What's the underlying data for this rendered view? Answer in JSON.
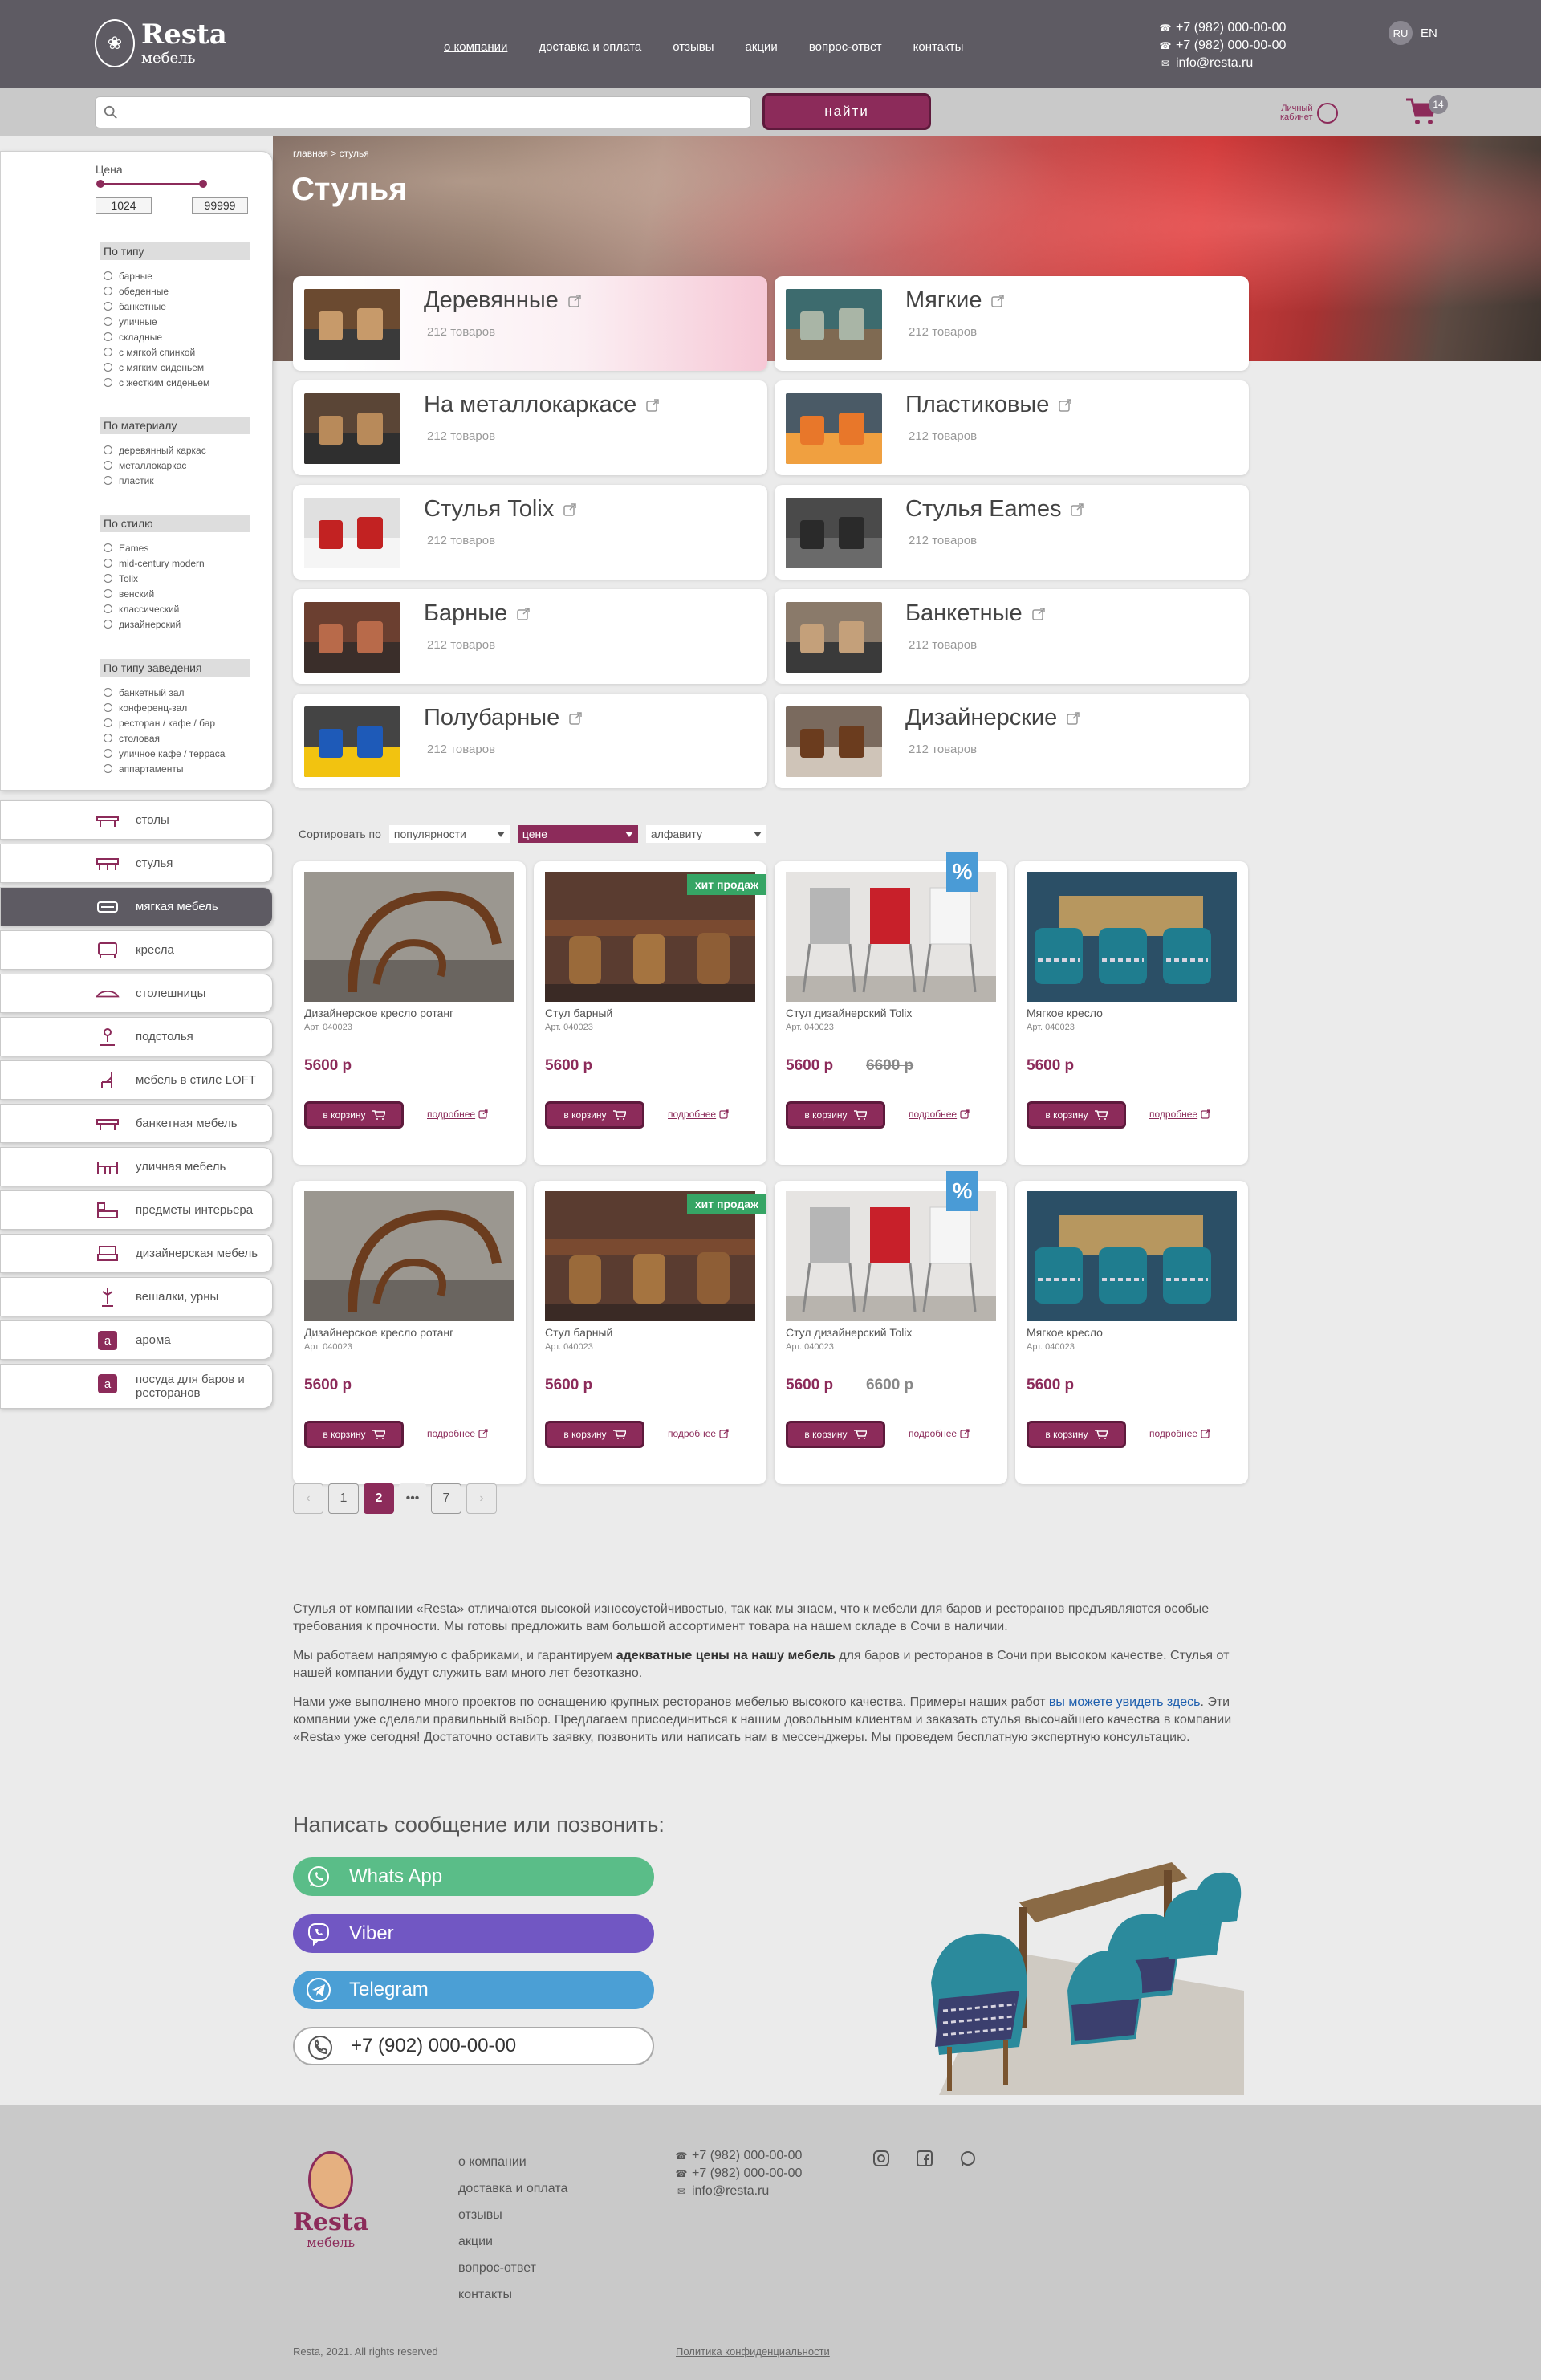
{
  "header": {
    "logo_main": "Resta",
    "logo_sub": "мебель",
    "nav": [
      "о компании",
      "доставка и оплата",
      "отзывы",
      "акции",
      "вопрос-ответ",
      "контакты"
    ],
    "phone1": "+7 (982) 000-00-00",
    "phone2": "+7 (982) 000-00-00",
    "email": "info@resta.ru",
    "lang_ru": "RU",
    "lang_en": "EN"
  },
  "search": {
    "placeholder": "",
    "button": "найти",
    "cabinet_line1": "Личный",
    "cabinet_line2": "кабинет",
    "cart_count": "14"
  },
  "breadcrumb": "главная > стулья",
  "page_title": "Стулья",
  "filters": {
    "price_label": "Цена",
    "price_min": "1024",
    "price_max": "99999",
    "groups": [
      {
        "title": "По типу",
        "options": [
          "барные",
          "обеденные",
          "банкетные",
          "уличные",
          "складные",
          "с мягкой спинкой",
          "с мягким сиденьем",
          "с жестким сиденьем"
        ]
      },
      {
        "title": "По материалу",
        "options": [
          "деревянный каркас",
          "металлокаркас",
          "пластик"
        ]
      },
      {
        "title": "По стилю",
        "options": [
          "Eames",
          "mid-century modern",
          "Tolix",
          "венский",
          "классический",
          "дизайнерский"
        ]
      },
      {
        "title": "По типу заведения",
        "options": [
          "банкетный зал",
          "конференц-зал",
          "ресторан / кафе / бар",
          "столовая",
          "уличное кафе / терраса",
          "аппартаменты"
        ]
      }
    ]
  },
  "categories": [
    {
      "label": "столы",
      "icon": "table-icon"
    },
    {
      "label": "стулья",
      "icon": "chairs-icon"
    },
    {
      "label": "мягкая мебель",
      "icon": "sofa-icon"
    },
    {
      "label": "кресла",
      "icon": "armchair-icon"
    },
    {
      "label": "столешницы",
      "icon": "tabletop-icon"
    },
    {
      "label": "подстолья",
      "icon": "table-base-icon"
    },
    {
      "label": "мебель в стиле LOFT",
      "icon": "loft-chair-icon"
    },
    {
      "label": "банкетная мебель",
      "icon": "banquet-icon"
    },
    {
      "label": "уличная мебель",
      "icon": "outdoor-icon"
    },
    {
      "label": "предметы интерьера",
      "icon": "interior-icon"
    },
    {
      "label": "дизайнерская мебель",
      "icon": "designer-icon"
    },
    {
      "label": "вешалки, урны",
      "icon": "hanger-icon"
    },
    {
      "label": "арома",
      "icon": "letter-a-icon"
    },
    {
      "label": "посуда для баров и ресторанов",
      "icon": "letter-a-icon"
    }
  ],
  "subcategories": [
    {
      "name": "Деревянные",
      "count": "212 товаров"
    },
    {
      "name": "Мягкие",
      "count": "212 товаров"
    },
    {
      "name": "На металлокаркасе",
      "count": "212 товаров"
    },
    {
      "name": "Пластиковые",
      "count": "212 товаров"
    },
    {
      "name": "Стулья Tolix",
      "count": "212 товаров"
    },
    {
      "name": "Стулья Eames",
      "count": "212 товаров"
    },
    {
      "name": "Барные",
      "count": "212 товаров"
    },
    {
      "name": "Банкетные",
      "count": "212 товаров"
    },
    {
      "name": "Полубарные",
      "count": "212 товаров"
    },
    {
      "name": "Дизайнерские",
      "count": "212 товаров"
    }
  ],
  "sort": {
    "label": "Сортировать по",
    "options": [
      "популярности",
      "цене",
      "алфавиту"
    ]
  },
  "products": [
    {
      "name": "Дизайнерское кресло ротанг",
      "art": "Арт. 040023",
      "price": "5600 р",
      "old_price": "",
      "badge": ""
    },
    {
      "name": "Стул барный",
      "art": "Арт. 040023",
      "price": "5600 р",
      "old_price": "",
      "badge": "хит продаж"
    },
    {
      "name": "Стул дизайнерский Tolix",
      "art": "Арт. 040023",
      "price": "5600 р",
      "old_price": "6600 р",
      "badge": "%"
    },
    {
      "name": "Мягкое кресло",
      "art": "Арт. 040023",
      "price": "5600 р",
      "old_price": "",
      "badge": ""
    },
    {
      "name": "Дизайнерское кресло ротанг",
      "art": "Арт. 040023",
      "price": "5600 р",
      "old_price": "",
      "badge": ""
    },
    {
      "name": "Стул барный",
      "art": "Арт. 040023",
      "price": "5600 р",
      "old_price": "",
      "badge": "хит продаж"
    },
    {
      "name": "Стул дизайнерский Tolix",
      "art": "Арт. 040023",
      "price": "5600 р",
      "old_price": "6600 р",
      "badge": "%"
    },
    {
      "name": "Мягкое кресло",
      "art": "Арт. 040023",
      "price": "5600 р",
      "old_price": "",
      "badge": ""
    }
  ],
  "product_buttons": {
    "cart": "в корзину",
    "more": "подробнее"
  },
  "pagination": {
    "pages": [
      "1",
      "2",
      "•••",
      "7"
    ],
    "current": "2"
  },
  "seo": {
    "p1": "Стулья от компании «Resta» отличаются высокой износоустойчивостью, так как мы знаем, что к мебели для баров и ресторанов предъявляются особые требования к прочности. Мы готовы предложить вам большой ассортимент товара на нашем складе в Сочи в наличии.",
    "p2a": "Мы работаем напрямую с фабриками, и гарантируем ",
    "p2b": "адекватные цены на нашу мебель",
    "p2c": " для баров и ресторанов в Сочи при высоком качестве. Стулья от нашей компании будут служить вам много лет безотказно.",
    "p3a": "Нами уже выполнено много проектов по оснащению крупных ресторанов мебелью высокого качества. Примеры наших работ ",
    "p3link": "вы можете увидеть здесь",
    "p3b": ". Эти компании уже сделали правильный выбор. Предлагаем присоединиться к нашим довольным клиентам и заказать стулья высочайшего качества в компании «Resta» уже сегодня! Достаточно оставить заявку, позвонить или написать нам в мессенджеры. Мы проведем бесплатную экспертную консультацию."
  },
  "contact": {
    "title": "Написать сообщение или позвонить:",
    "whatsapp": "Whats App",
    "viber": "Viber",
    "telegram": "Telegram",
    "phone": "+7 (902) 000-00-00"
  },
  "footer": {
    "logo_main": "Resta",
    "logo_sub": "мебель",
    "nav": [
      "о компании",
      "доставка и оплата",
      "отзывы",
      "акции",
      "вопрос-ответ",
      "контакты"
    ],
    "phone1": "+7 (982) 000-00-00",
    "phone2": "+7 (982) 000-00-00",
    "email": "info@resta.ru",
    "copyright": "Resta, 2021. All rights reserved",
    "policy": "Политика конфиденциальности"
  },
  "colors": {
    "brand": "#8c2b5a",
    "header": "#5e5b63",
    "whatsapp": "#5abd88",
    "viber": "#7157c3",
    "telegram": "#4b9fd5",
    "hit_badge": "#36a565",
    "sale_badge": "#4a9bd6"
  }
}
